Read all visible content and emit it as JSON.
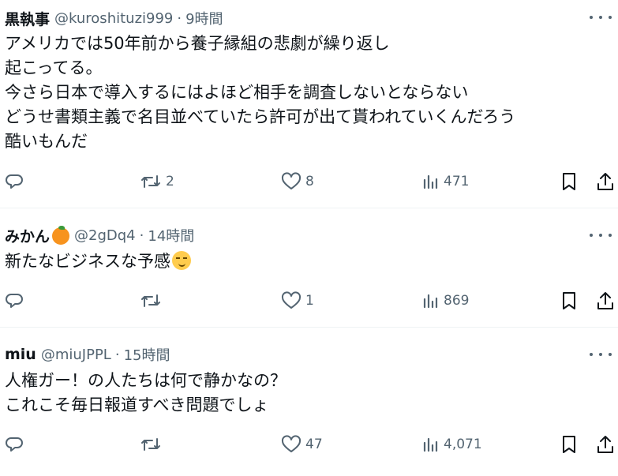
{
  "tweets": [
    {
      "name": "黒執事",
      "handle": "@kuroshituzi999",
      "time": "9時間",
      "lines": [
        "アメリカでは50年前から養子縁組の悲劇が繰り返し",
        "起こってる。",
        "今さら日本で導入するにはよほど相手を調査しないとならない",
        "どうせ書類主義で名目並べていたら許可が出て貰われていくんだろう",
        "酷いもんだ"
      ],
      "replies": "",
      "retweets": "2",
      "likes": "8",
      "views": "471"
    },
    {
      "name": "みかん",
      "name_emoji": "orange-emoji",
      "handle": "@2gDq4",
      "time": "14時間",
      "lines": [
        "新たなビジネスな予感"
      ],
      "text_emoji": "smirking-face-emoji",
      "replies": "",
      "retweets": "",
      "likes": "1",
      "views": "869"
    },
    {
      "name": "miu",
      "handle": "@miuJPPL",
      "time": "15時間",
      "lines": [
        "人権ガー！の人たちは何で静かなの？",
        "これこそ毎日報道すべき問題でしょ"
      ],
      "replies": "",
      "retweets": "",
      "likes": "47",
      "views": "4,071"
    }
  ],
  "separator": "·",
  "icons": [
    "reply-icon",
    "retweet-icon",
    "like-icon",
    "views-icon",
    "bookmark-icon",
    "share-icon",
    "more-icon"
  ],
  "colors": {
    "text": "#0f1419",
    "secondary": "#536471",
    "divider": "#eff3f4"
  }
}
